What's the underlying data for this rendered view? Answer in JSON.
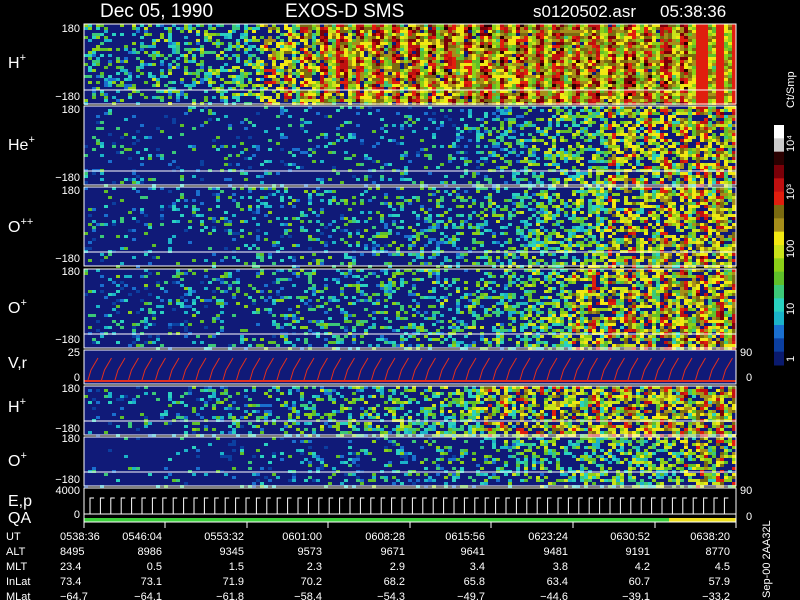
{
  "header": {
    "date": "Dec 05, 1990",
    "instrument": "EXOS-D SMS",
    "file": "s0120502.asr",
    "time": "05:38:36"
  },
  "colorbar": {
    "unit": "Ct/Smp",
    "ticks": [
      "10⁴",
      "10³",
      "100",
      "10",
      "1"
    ],
    "colors": [
      "#0a1a6e",
      "#0b3fa0",
      "#1a6fcf",
      "#1bb3c9",
      "#2ad1c0",
      "#3cc878",
      "#5fbf2a",
      "#8ccf18",
      "#c9e21a",
      "#f2e812",
      "#a68e1a",
      "#7a6a10",
      "#e01e0e",
      "#c01010",
      "#7a0008",
      "#2a0000",
      "#cccccc",
      "#ffffff"
    ]
  },
  "panels": {
    "hplus": {
      "label": "H+",
      "ymax": "180",
      "ymin": "−180"
    },
    "heplus": {
      "label": "He+",
      "ymax": "180",
      "ymin": "−180"
    },
    "oplusplus": {
      "label": "O++",
      "ymax": "180",
      "ymin": "−180"
    },
    "oplus": {
      "label": "O+",
      "ymax": "180",
      "ymin": "−180"
    },
    "vr": {
      "label": "V,r",
      "ymax": "25",
      "ymin": "0",
      "right": "90",
      "right_low": "0"
    },
    "hplus2": {
      "label": "H+",
      "ymax": "180",
      "ymin": "−180"
    },
    "oplus2": {
      "label": "O+",
      "ymax": "180",
      "ymin": "−180"
    },
    "ep": {
      "label1": "E,p",
      "label2": "QA",
      "ymax": "4000",
      "ymin": "0",
      "right": "90",
      "right_low": "0"
    }
  },
  "footer": {
    "row_labels": [
      "UT",
      "ALT",
      "MLT",
      "InLat",
      "MLat"
    ],
    "columns": [
      [
        "0538:36",
        "8495",
        "23.4",
        "73.4",
        "−64.7"
      ],
      [
        "0546:04",
        "8986",
        "0.5",
        "73.1",
        "−64.1"
      ],
      [
        "0553:32",
        "9345",
        "1.5",
        "71.9",
        "−61.8"
      ],
      [
        "0601:00",
        "9573",
        "2.3",
        "70.2",
        "−58.4"
      ],
      [
        "0608:28",
        "9671",
        "2.9",
        "68.2",
        "−54.3"
      ],
      [
        "0615:56",
        "9641",
        "3.4",
        "65.8",
        "−49.7"
      ],
      [
        "0623:24",
        "9481",
        "3.8",
        "63.4",
        "−44.6"
      ],
      [
        "0630:52",
        "9191",
        "4.2",
        "60.7",
        "−39.1"
      ],
      [
        "0638:20",
        "8770",
        "4.5",
        "57.9",
        "−33.2"
      ]
    ],
    "side_note": "Sep-00 2AA32L"
  },
  "chart_data": {
    "type": "heatmap",
    "x_ticks": [
      "0538:36",
      "0546:04",
      "0553:32",
      "0601:00",
      "0608:28",
      "0615:56",
      "0623:24",
      "0630:52",
      "0638:20"
    ],
    "panels": [
      {
        "name": "H+",
        "ylim": [
          -180,
          180
        ],
        "activity": [
          [
            0.0,
            0.35
          ],
          [
            0.2,
            0.45
          ],
          [
            0.38,
            0.9
          ],
          [
            0.55,
            0.95
          ],
          [
            0.7,
            0.98
          ],
          [
            1.0,
            1.0
          ]
        ]
      },
      {
        "name": "He+",
        "ylim": [
          -180,
          180
        ],
        "activity": [
          [
            0.0,
            0.12
          ],
          [
            0.55,
            0.18
          ],
          [
            0.75,
            0.55
          ],
          [
            1.0,
            0.8
          ]
        ]
      },
      {
        "name": "O++",
        "ylim": [
          -180,
          180
        ],
        "activity": [
          [
            0.0,
            0.12
          ],
          [
            0.6,
            0.35
          ],
          [
            0.8,
            0.6
          ],
          [
            1.0,
            0.82
          ]
        ]
      },
      {
        "name": "O+",
        "ylim": [
          -180,
          180
        ],
        "activity": [
          [
            0.0,
            0.15
          ],
          [
            0.6,
            0.4
          ],
          [
            0.8,
            0.7
          ],
          [
            1.0,
            0.88
          ]
        ]
      },
      {
        "name": "H+",
        "ylim": [
          -180,
          180
        ],
        "activity": [
          [
            0.0,
            0.1
          ],
          [
            0.25,
            0.3
          ],
          [
            0.55,
            0.55
          ],
          [
            0.8,
            0.75
          ],
          [
            1.0,
            0.8
          ]
        ]
      },
      {
        "name": "O+",
        "ylim": [
          -180,
          180
        ],
        "activity": [
          [
            0.0,
            0.05
          ],
          [
            0.55,
            0.25
          ],
          [
            0.75,
            0.5
          ],
          [
            1.0,
            0.65
          ]
        ]
      }
    ]
  }
}
